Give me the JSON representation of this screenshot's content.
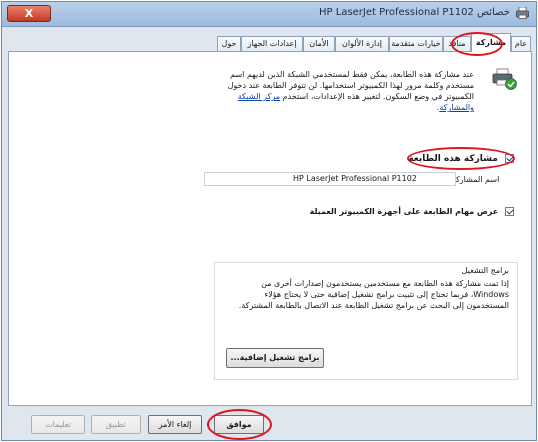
{
  "window": {
    "title": "خصائص HP LaserJet Professional P1102",
    "close_label": "X",
    "colors": {
      "accent": "#e0141e",
      "link": "#0645ad",
      "titlebar": "#9db9dc"
    }
  },
  "tabs": [
    {
      "label": "عام",
      "active": false
    },
    {
      "label": "مشاركة",
      "active": true
    },
    {
      "label": "منافذ",
      "active": false
    },
    {
      "label": "خيارات متقدمة",
      "active": false
    },
    {
      "label": "إدارة الألوان",
      "active": false
    },
    {
      "label": "الأمان",
      "active": false
    },
    {
      "label": "إعدادات الجهاز",
      "active": false
    },
    {
      "label": "حول",
      "active": false
    }
  ],
  "sharing": {
    "info_text": "عند مشاركة هذه الطابعة، يمكن فقط لمستخدمي الشبكة الذين لديهم اسم مستخدم وكلمة مرور لهذا الكمبيوتر استخدامها. لن تتوفر الطابعة عند دخول الكمبيوتر في وضع السكون. لتغيير هذه الإعدادات، استخدم",
    "info_link": "مركز الشبكة والمشاركة",
    "share_checkbox_label": "مشاركة هذه الطابعة",
    "share_name_label": "اسم المشاركة:",
    "share_name_value": "HP LaserJet Professional P1102",
    "render_checkbox_label": "عرض مهام الطابعة على أجهزة الكمبيوتر العميلة",
    "drivers_title": "برامج التشغيل",
    "drivers_text": "إذا تمت مشاركة هذه الطابعة مع مستخدمين يستخدمون إصدارات أخرى من Windows، فربما تحتاج إلى تثبيت برامج تشغيل إضافية حتى لا يحتاج هؤلاء المستخدمون إلى البحث عن برامج تشغيل الطابعة عند الاتصال بالطابعة المشتركة.",
    "drivers_button": "برامج تشغيل إضافية..."
  },
  "footer": {
    "ok": "موافق",
    "cancel": "إلغاء الأمر",
    "apply": "تطبيق",
    "help": "تعليمات"
  }
}
